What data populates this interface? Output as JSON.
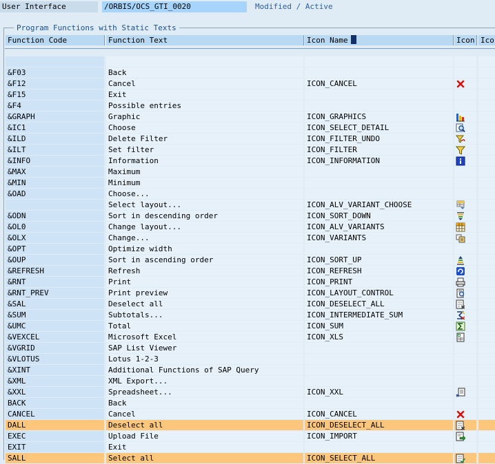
{
  "toolbar": {
    "label": "User Interface",
    "value": "/ORBIS/OCS_GTI_0020",
    "status": "Modified / Active"
  },
  "group": {
    "title": "Program Functions with Static Texts"
  },
  "columns": [
    "Function Code",
    "Function Text",
    "Icon Name",
    "Icon",
    "Ico"
  ],
  "rows": [
    {
      "code": "",
      "text": "",
      "icon_name": "",
      "icon": "",
      "selected": false
    },
    {
      "code": "&F03",
      "text": "Back",
      "icon_name": "",
      "icon": "",
      "selected": false
    },
    {
      "code": "&F12",
      "text": "Cancel",
      "icon_name": "ICON_CANCEL",
      "icon": "cancel-icon",
      "selected": false
    },
    {
      "code": "&F15",
      "text": "Exit",
      "icon_name": "",
      "icon": "",
      "selected": false
    },
    {
      "code": "&F4",
      "text": "Possible entries",
      "icon_name": "",
      "icon": "",
      "selected": false
    },
    {
      "code": "&GRAPH",
      "text": "Graphic",
      "icon_name": "ICON_GRAPHICS",
      "icon": "graphics-icon",
      "selected": false
    },
    {
      "code": "&IC1",
      "text": "Choose",
      "icon_name": "ICON_SELECT_DETAIL",
      "icon": "select-detail-icon",
      "selected": false
    },
    {
      "code": "&ILD",
      "text": "Delete Filter",
      "icon_name": "ICON_FILTER_UNDO",
      "icon": "filter-undo-icon",
      "selected": false
    },
    {
      "code": "&ILT",
      "text": "Set filter",
      "icon_name": "ICON_FILTER",
      "icon": "filter-icon",
      "selected": false
    },
    {
      "code": "&INFO",
      "text": "Information",
      "icon_name": "ICON_INFORMATION",
      "icon": "information-icon",
      "selected": false
    },
    {
      "code": "&MAX",
      "text": "Maximum",
      "icon_name": "",
      "icon": "",
      "selected": false
    },
    {
      "code": "&MIN",
      "text": "Minimum",
      "icon_name": "",
      "icon": "",
      "selected": false
    },
    {
      "code": "&OAD",
      "text": "Choose...",
      "icon_name": "",
      "icon": "",
      "selected": false
    },
    {
      "code": "",
      "text": "Select layout...",
      "icon_name": "ICON_ALV_VARIANT_CHOOSE",
      "icon": "alv-variant-choose-icon",
      "selected": false
    },
    {
      "code": "&ODN",
      "text": "Sort in descending order",
      "icon_name": "ICON_SORT_DOWN",
      "icon": "sort-down-icon",
      "selected": false
    },
    {
      "code": "&OL0",
      "text": "Change layout...",
      "icon_name": "ICON_ALV_VARIANTS",
      "icon": "alv-variants-icon",
      "selected": false
    },
    {
      "code": "&OLX",
      "text": "Change...",
      "icon_name": "ICON_VARIANTS",
      "icon": "variants-icon",
      "selected": false
    },
    {
      "code": "&OPT",
      "text": "Optimize width",
      "icon_name": "",
      "icon": "",
      "selected": false
    },
    {
      "code": "&OUP",
      "text": "Sort in ascending order",
      "icon_name": "ICON_SORT_UP",
      "icon": "sort-up-icon",
      "selected": false
    },
    {
      "code": "&REFRESH",
      "text": "Refresh",
      "icon_name": "ICON_REFRESH",
      "icon": "refresh-icon",
      "selected": false
    },
    {
      "code": "&RNT",
      "text": "Print",
      "icon_name": "ICON_PRINT",
      "icon": "print-icon",
      "selected": false
    },
    {
      "code": "&RNT_PREV",
      "text": "Print preview",
      "icon_name": "ICON_LAYOUT_CONTROL",
      "icon": "layout-control-icon",
      "selected": false
    },
    {
      "code": "&SAL",
      "text": "Deselect all",
      "icon_name": "ICON_DESELECT_ALL",
      "icon": "deselect-all-icon",
      "selected": false
    },
    {
      "code": "&SUM",
      "text": "Subtotals...",
      "icon_name": "ICON_INTERMEDIATE_SUM",
      "icon": "intermediate-sum-icon",
      "selected": false
    },
    {
      "code": "&UMC",
      "text": "Total",
      "icon_name": "ICON_SUM",
      "icon": "sum-icon",
      "selected": false
    },
    {
      "code": "&VEXCEL",
      "text": "Microsoft Excel",
      "icon_name": "ICON_XLS",
      "icon": "xls-icon",
      "selected": false
    },
    {
      "code": "&VGRID",
      "text": "SAP List Viewer",
      "icon_name": "",
      "icon": "",
      "selected": false
    },
    {
      "code": "&VLOTUS",
      "text": "Lotus 1-2-3",
      "icon_name": "",
      "icon": "",
      "selected": false
    },
    {
      "code": "&XINT",
      "text": "Additional Functions of SAP Query",
      "icon_name": "",
      "icon": "",
      "selected": false
    },
    {
      "code": "&XML",
      "text": "XML Export...",
      "icon_name": "",
      "icon": "",
      "selected": false
    },
    {
      "code": "&XXL",
      "text": "Spreadsheet...",
      "icon_name": "ICON_XXL",
      "icon": "xxl-icon",
      "selected": false
    },
    {
      "code": "BACK",
      "text": "Back",
      "icon_name": "",
      "icon": "",
      "selected": false
    },
    {
      "code": "CANCEL",
      "text": "Cancel",
      "icon_name": "ICON_CANCEL",
      "icon": "cancel-icon",
      "selected": false
    },
    {
      "code": "DALL",
      "text": "Deselect all",
      "icon_name": "ICON_DESELECT_ALL",
      "icon": "deselect-all-icon",
      "selected": true
    },
    {
      "code": "EXEC",
      "text": "Upload File",
      "icon_name": "ICON_IMPORT",
      "icon": "import-icon",
      "selected": false
    },
    {
      "code": "EXIT",
      "text": "Exit",
      "icon_name": "",
      "icon": "",
      "selected": false
    },
    {
      "code": "SALL",
      "text": "Select all",
      "icon_name": "ICON_SELECT_ALL",
      "icon": "select-all-icon",
      "selected": true
    }
  ]
}
